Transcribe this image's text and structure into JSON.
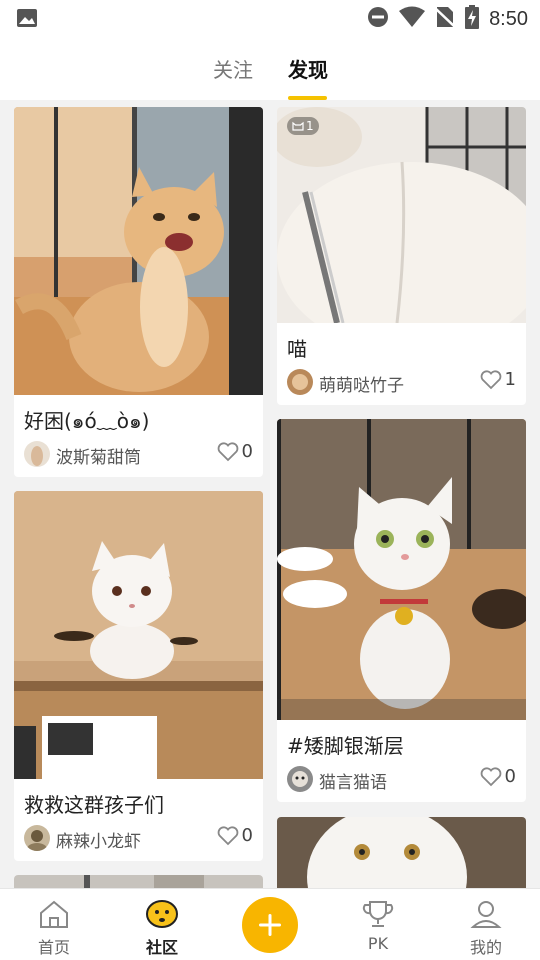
{
  "status_bar": {
    "time": "8:50"
  },
  "top_tabs": [
    {
      "label": "关注",
      "active": false
    },
    {
      "label": "发现",
      "active": true
    }
  ],
  "feed": {
    "left": [
      {
        "title": "好困(๑ó﹏ò๑)",
        "author": "波斯菊甜筒",
        "likes": "0"
      },
      {
        "title": "救救这群孩子们",
        "author": "麻辣小龙虾",
        "likes": "0"
      }
    ],
    "right": [
      {
        "badge": "1",
        "title": "喵",
        "author": "萌萌哒竹子",
        "likes": "1"
      },
      {
        "title": "#矮脚银渐层",
        "author": "猫言猫语",
        "likes": "0"
      }
    ]
  },
  "bottom_nav": [
    {
      "label": "首页",
      "icon": "home-icon",
      "active": false
    },
    {
      "label": "社区",
      "icon": "community-icon",
      "active": true
    },
    {
      "label": "",
      "icon": "add-icon",
      "active": false
    },
    {
      "label": "PK",
      "icon": "trophy-icon",
      "active": false
    },
    {
      "label": "我的",
      "icon": "profile-icon",
      "active": false
    }
  ],
  "colors": {
    "accent": "#f5c200",
    "add_button": "#f8b500",
    "background": "#f2f2f2"
  }
}
